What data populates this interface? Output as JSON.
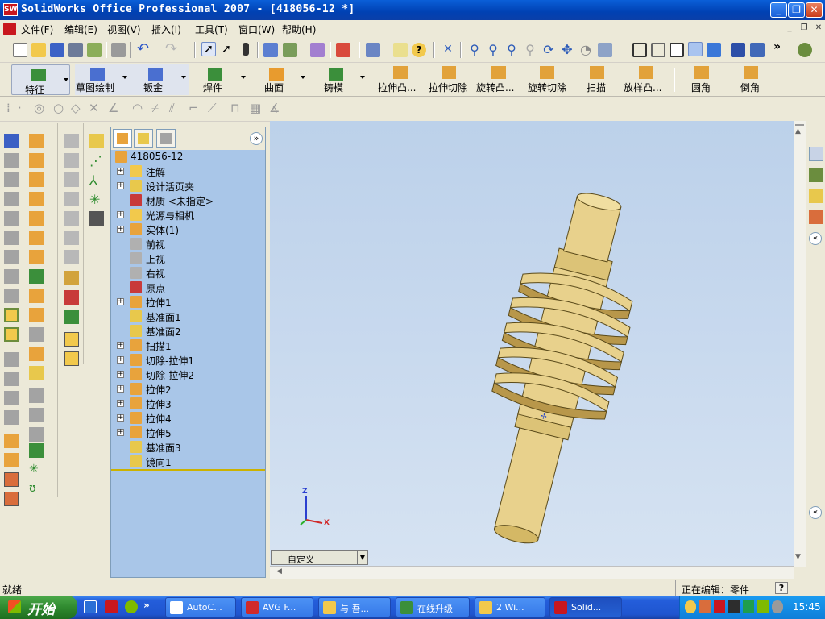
{
  "window": {
    "title": "SolidWorks Office Professional 2007 - [418056-12 *]",
    "app_icon_text": "SW"
  },
  "menu": {
    "items": [
      "文件(F)",
      "编辑(E)",
      "视图(V)",
      "插入(I)",
      "工具(T)",
      "窗口(W)",
      "帮助(H)"
    ]
  },
  "feature_tabs": [
    {
      "label": "特征",
      "color": "#3b8f3b"
    },
    {
      "label": "草图绘制",
      "color": "#4a6fd0"
    },
    {
      "label": "钣金",
      "color": "#4a6fd0"
    },
    {
      "label": "焊件",
      "color": "#3b8f3b"
    },
    {
      "label": "曲面",
      "color": "#e89b2e"
    },
    {
      "label": "铸模",
      "color": "#3b8f3b"
    }
  ],
  "feature_commands": [
    {
      "label": "拉伸凸...",
      "color": "#e2a23a"
    },
    {
      "label": "拉伸切除",
      "color": "#e2a23a"
    },
    {
      "label": "旋转凸...",
      "color": "#e2a23a"
    },
    {
      "label": "旋转切除",
      "color": "#e2a23a"
    },
    {
      "label": "扫描",
      "color": "#e2a23a"
    },
    {
      "label": "放样凸...",
      "color": "#e2a23a"
    },
    {
      "label": "圆角",
      "color": "#e2a23a"
    },
    {
      "label": "倒角",
      "color": "#e2a23a"
    }
  ],
  "tree": {
    "root": "418056-12",
    "items": [
      {
        "label": "注解",
        "expand": "+",
        "icon": "annotation"
      },
      {
        "label": "设计活页夹",
        "expand": "+",
        "icon": "binder"
      },
      {
        "label": "材质 <未指定>",
        "expand": "",
        "icon": "material"
      },
      {
        "label": "光源与相机",
        "expand": "+",
        "icon": "lights"
      },
      {
        "label": "实体(1)",
        "expand": "+",
        "icon": "solid"
      },
      {
        "label": "前视",
        "expand": "",
        "icon": "plane"
      },
      {
        "label": "上视",
        "expand": "",
        "icon": "plane"
      },
      {
        "label": "右视",
        "expand": "",
        "icon": "plane"
      },
      {
        "label": "原点",
        "expand": "",
        "icon": "origin"
      },
      {
        "label": "拉伸1",
        "expand": "+",
        "icon": "extrude"
      },
      {
        "label": "基准面1",
        "expand": "",
        "icon": "refplane"
      },
      {
        "label": "基准面2",
        "expand": "",
        "icon": "refplane"
      },
      {
        "label": "扫描1",
        "expand": "+",
        "icon": "sweep"
      },
      {
        "label": "切除-拉伸1",
        "expand": "+",
        "icon": "cut"
      },
      {
        "label": "切除-拉伸2",
        "expand": "+",
        "icon": "cut"
      },
      {
        "label": "拉伸2",
        "expand": "+",
        "icon": "extrude"
      },
      {
        "label": "拉伸3",
        "expand": "+",
        "icon": "extrude"
      },
      {
        "label": "拉伸4",
        "expand": "+",
        "icon": "extrude"
      },
      {
        "label": "拉伸5",
        "expand": "+",
        "icon": "extrude"
      },
      {
        "label": "基准面3",
        "expand": "",
        "icon": "refplane"
      },
      {
        "label": "镜向1",
        "expand": "",
        "icon": "mirror"
      }
    ]
  },
  "viewport": {
    "view_selector": "自定义",
    "triad": {
      "x": "X",
      "y": "Y",
      "z": "Z"
    }
  },
  "status": {
    "left": "就绪",
    "right": "正在编辑：零件",
    "help": "?"
  },
  "taskbar": {
    "start": "开始",
    "tasks": [
      {
        "label": "AutoC...",
        "active": false
      },
      {
        "label": "AVG F...",
        "active": false
      },
      {
        "label": "与 吾...",
        "active": false
      },
      {
        "label": "在线升级",
        "active": false
      },
      {
        "label": "2 Wi...",
        "active": false
      },
      {
        "label": "Solid...",
        "active": true
      }
    ],
    "clock": "15:45"
  },
  "colors": {
    "part": "#e8d18c",
    "part_shadow": "#b8974a",
    "panel": "#a9c6e8"
  }
}
